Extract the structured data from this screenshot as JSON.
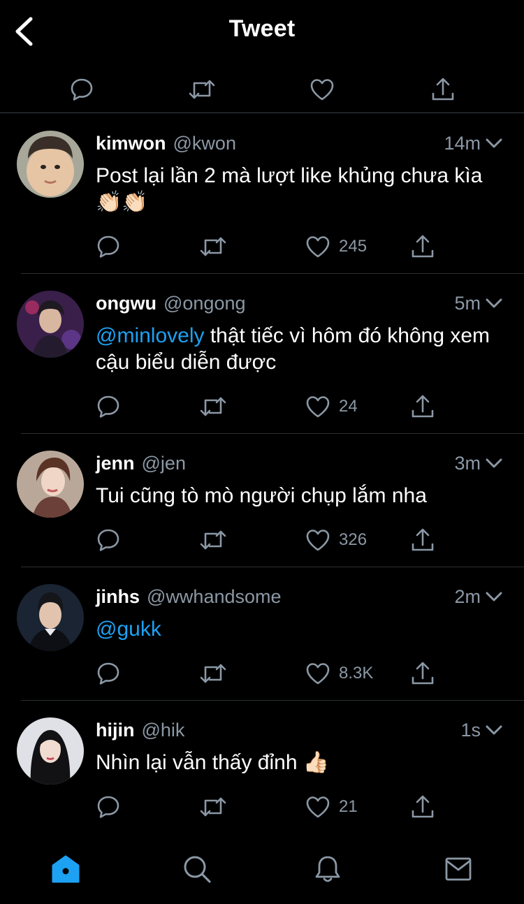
{
  "header": {
    "title": "Tweet",
    "back_icon": "chevron-left-icon"
  },
  "action_bar": [
    "reply-icon",
    "retweet-icon",
    "like-icon",
    "share-icon"
  ],
  "colors": {
    "background": "#000000",
    "accent": "#1da1f2",
    "muted": "#8b98a5",
    "divider": "#2a2f33"
  },
  "tweets": [
    {
      "name": "kimwon",
      "handle": "@kwon",
      "time": "14m",
      "mention": "",
      "text": "Post lại lần 2 mà lượt like khủng chưa kìa 👏🏻👏🏻",
      "likes": "245"
    },
    {
      "name": "ongwu",
      "handle": "@ongong",
      "time": "5m",
      "mention": "@minlovely",
      "text": " thật tiếc vì hôm đó không xem cậu biểu diễn được",
      "likes": "24"
    },
    {
      "name": "jenn",
      "handle": "@jen",
      "time": "3m",
      "mention": "",
      "text": "Tui cũng tò mò người chụp lắm nha",
      "likes": "326"
    },
    {
      "name": "jinhs",
      "handle": "@wwhandsome",
      "time": "2m",
      "mention": "@gukk",
      "text": "",
      "likes": "8.3K"
    },
    {
      "name": "hijin",
      "handle": "@hik",
      "time": "1s",
      "mention": "",
      "text": "Nhìn lại vẫn thấy đỉnh 👍🏻",
      "likes": "21"
    }
  ],
  "tabbar": [
    "home-icon",
    "search-icon",
    "notifications-icon",
    "messages-icon"
  ]
}
